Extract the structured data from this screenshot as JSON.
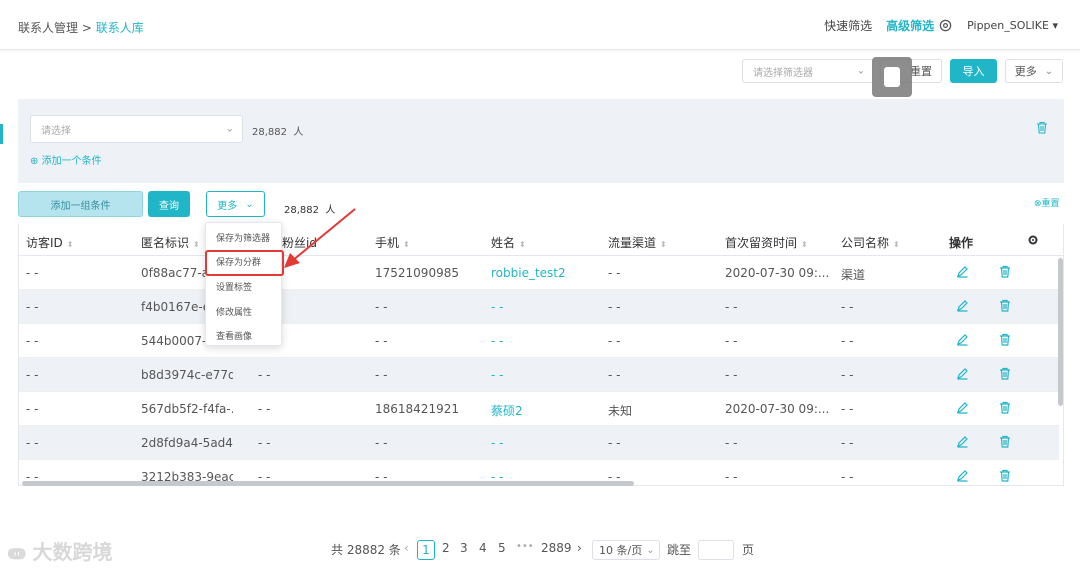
{
  "header": {
    "breadcrumb_parent": "联系人管理 >",
    "breadcrumb_current": "联系人库",
    "quick_filter": "快速筛选",
    "advanced_filter": "高级筛选",
    "user": "Pippen_SOLIKE"
  },
  "toolbar": {
    "filter_placeholder": "请选择筛选器",
    "reset_label": "重置",
    "import_label": "导入",
    "more_label": "更多"
  },
  "filter_panel": {
    "select_placeholder": "请选择",
    "count": "28,882",
    "count_unit": "人",
    "add_condition": "添加一个条件"
  },
  "actions": {
    "add_group": "添加一组条件",
    "query": "查询",
    "more": "更多",
    "count": "28,882",
    "count_unit": "人",
    "reset_link": "重置"
  },
  "menu": {
    "items": [
      "保存为筛选器",
      "保存为分群",
      "设置标签",
      "修改属性",
      "查看画像"
    ],
    "highlight_color": "#e53935"
  },
  "table": {
    "columns": [
      "访客ID",
      "匿名标识",
      "粉丝id",
      "手机",
      "姓名",
      "流量渠道",
      "首次留资时间",
      "公司名称",
      "操作"
    ],
    "rows": [
      {
        "visitor": "- -",
        "anon": "0f88ac77-a7",
        "fans": "",
        "phone": "17521090985",
        "name": "robbie_test2",
        "channel": "- -",
        "time": "2020-07-30 09:...",
        "company": "渠道"
      },
      {
        "visitor": "- -",
        "anon": "f4b0167e-e3",
        "fans": "",
        "phone": "- -",
        "name": "- -",
        "channel": "- -",
        "time": "- -",
        "company": "- -"
      },
      {
        "visitor": "- -",
        "anon": "544b0007-9a",
        "fans": "",
        "phone": "- -",
        "name": "- -",
        "channel": "- -",
        "time": "- -",
        "company": "- -"
      },
      {
        "visitor": "- -",
        "anon": "b8d3974c-e77d...",
        "fans": "- -",
        "phone": "- -",
        "name": "- -",
        "channel": "- -",
        "time": "- -",
        "company": "- -"
      },
      {
        "visitor": "- -",
        "anon": "567db5f2-f4fa-...",
        "fans": "- -",
        "phone": "18618421921",
        "name": "蔡硕2",
        "channel": "未知",
        "time": "2020-07-30 09:...",
        "company": "- -"
      },
      {
        "visitor": "- -",
        "anon": "2d8fd9a4-5ad4...",
        "fans": "- -",
        "phone": "- -",
        "name": "- -",
        "channel": "- -",
        "time": "- -",
        "company": "- -"
      },
      {
        "visitor": "- -",
        "anon": "3212b383-9eac...",
        "fans": "- -",
        "phone": "- -",
        "name": "- -",
        "channel": "- -",
        "time": "- -",
        "company": "- -"
      }
    ]
  },
  "pagination": {
    "total": "共 28882 条",
    "current": "1",
    "pages": [
      "2",
      "3",
      "4",
      "5"
    ],
    "ellipsis": "•••",
    "last": "2889",
    "page_size": "10 条/页",
    "goto": "跳至",
    "page_unit": "页"
  },
  "watermark": "大数跨境",
  "colors": {
    "accent": "#21b5c8",
    "alt_row": "#eef1f6"
  }
}
